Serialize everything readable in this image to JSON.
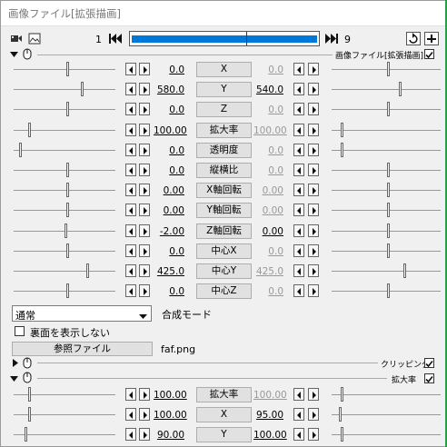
{
  "title": "画像ファイル[拡張描画]",
  "timeline": {
    "start": "1",
    "end": "9"
  },
  "section_header": "画像ファイル[拡張描画]",
  "rows": [
    {
      "label": "X",
      "left": "0.0",
      "right": "0.0",
      "left_active": true,
      "right_active": false
    },
    {
      "label": "Y",
      "left": "580.0",
      "right": "540.0",
      "left_active": true,
      "right_active": true
    },
    {
      "label": "Z",
      "left": "0.0",
      "right": "0.0",
      "left_active": true,
      "right_active": false
    },
    {
      "label": "拡大率",
      "left": "100.00",
      "right": "100.00",
      "left_active": true,
      "right_active": false
    },
    {
      "label": "透明度",
      "left": "0.0",
      "right": "0.0",
      "left_active": true,
      "right_active": false
    },
    {
      "label": "縦横比",
      "left": "0.0",
      "right": "0.0",
      "left_active": true,
      "right_active": false
    },
    {
      "label": "X軸回転",
      "left": "0.00",
      "right": "0.00",
      "left_active": true,
      "right_active": false
    },
    {
      "label": "Y軸回転",
      "left": "0.00",
      "right": "0.00",
      "left_active": true,
      "right_active": false
    },
    {
      "label": "Z軸回転",
      "left": "-2.00",
      "right": "0.00",
      "left_active": true,
      "right_active": true
    },
    {
      "label": "中心X",
      "left": "0.0",
      "right": "0.0",
      "left_active": true,
      "right_active": false
    },
    {
      "label": "中心Y",
      "left": "425.0",
      "right": "425.0",
      "left_active": true,
      "right_active": false
    },
    {
      "label": "中心Z",
      "left": "0.0",
      "right": "0.0",
      "left_active": true,
      "right_active": false
    }
  ],
  "blend": {
    "value": "通常",
    "label": "合成モード"
  },
  "hide_back_label": "裏面を表示しない",
  "ref_button": "参照ファイル",
  "ref_file": "faf.png",
  "clipping_label": "クリッピング",
  "zoom_label": "拡大率",
  "zoom_rows": [
    {
      "label": "拡大率",
      "left": "100.00",
      "right": "100.00",
      "left_active": true,
      "right_active": false
    },
    {
      "label": "X",
      "left": "100.00",
      "right": "95.00",
      "left_active": true,
      "right_active": true
    },
    {
      "label": "Y",
      "left": "90.00",
      "right": "100.00",
      "left_active": true,
      "right_active": true
    }
  ],
  "colors": {
    "timeline_bar": "#0078d7",
    "cursor": "#c00000"
  }
}
